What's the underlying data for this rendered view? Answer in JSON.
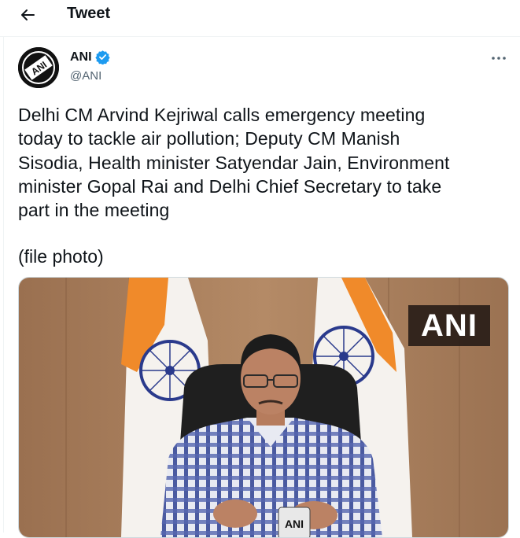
{
  "header": {
    "title": "Tweet"
  },
  "author": {
    "name": "ANI",
    "handle": "@ANI",
    "avatar_text": "ANI"
  },
  "tweet": {
    "lines": [
      "Delhi CM Arvind Kejriwal calls emergency meeting",
      "today to tackle air pollution; Deputy CM Manish",
      "Sisodia, Health minister Satyendar Jain, Environment",
      "minister Gopal Rai and Delhi Chief Secretary to take",
      "part in the meeting"
    ],
    "caption": "(file photo)"
  },
  "media": {
    "watermark": "ANI",
    "mic_label": "ANI"
  },
  "colors": {
    "verified": "#1d9bf0",
    "text": "#0f1419",
    "secondary": "#536471"
  }
}
